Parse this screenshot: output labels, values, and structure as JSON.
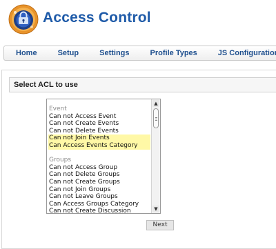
{
  "app": {
    "title": "Access Control",
    "logo_icon": "shield-lock-icon"
  },
  "nav": {
    "items": [
      {
        "label": "Home"
      },
      {
        "label": "Setup"
      },
      {
        "label": "Settings"
      },
      {
        "label": "Profile Types"
      },
      {
        "label": "JS Configuration"
      }
    ]
  },
  "panel": {
    "title": "Select ACL to use"
  },
  "acl_list": {
    "groups": [
      {
        "label": "Event",
        "options": [
          {
            "label": "Can not Access Event",
            "selected": false
          },
          {
            "label": "Can not Create Events",
            "selected": false
          },
          {
            "label": "Can not Delete Events",
            "selected": false
          },
          {
            "label": "Can not Join Events",
            "selected": true
          },
          {
            "label": "Can Access Events Category",
            "selected": true
          }
        ]
      },
      {
        "label": "Groups",
        "options": [
          {
            "label": "Can not Access Group",
            "selected": false
          },
          {
            "label": "Can not Delete Groups",
            "selected": false
          },
          {
            "label": "Can not Create Groups",
            "selected": false
          },
          {
            "label": "Can not Join Groups",
            "selected": false
          },
          {
            "label": "Can not Leave Groups",
            "selected": false
          },
          {
            "label": "Can Access Groups Category",
            "selected": false
          },
          {
            "label": "Can not Create Discussion",
            "selected": false
          }
        ]
      }
    ],
    "highlight_color": "#fff8a6"
  },
  "actions": {
    "next_label": "Next"
  },
  "colors": {
    "title": "#1e5aa8",
    "nav_text": "#1e4f8e"
  }
}
